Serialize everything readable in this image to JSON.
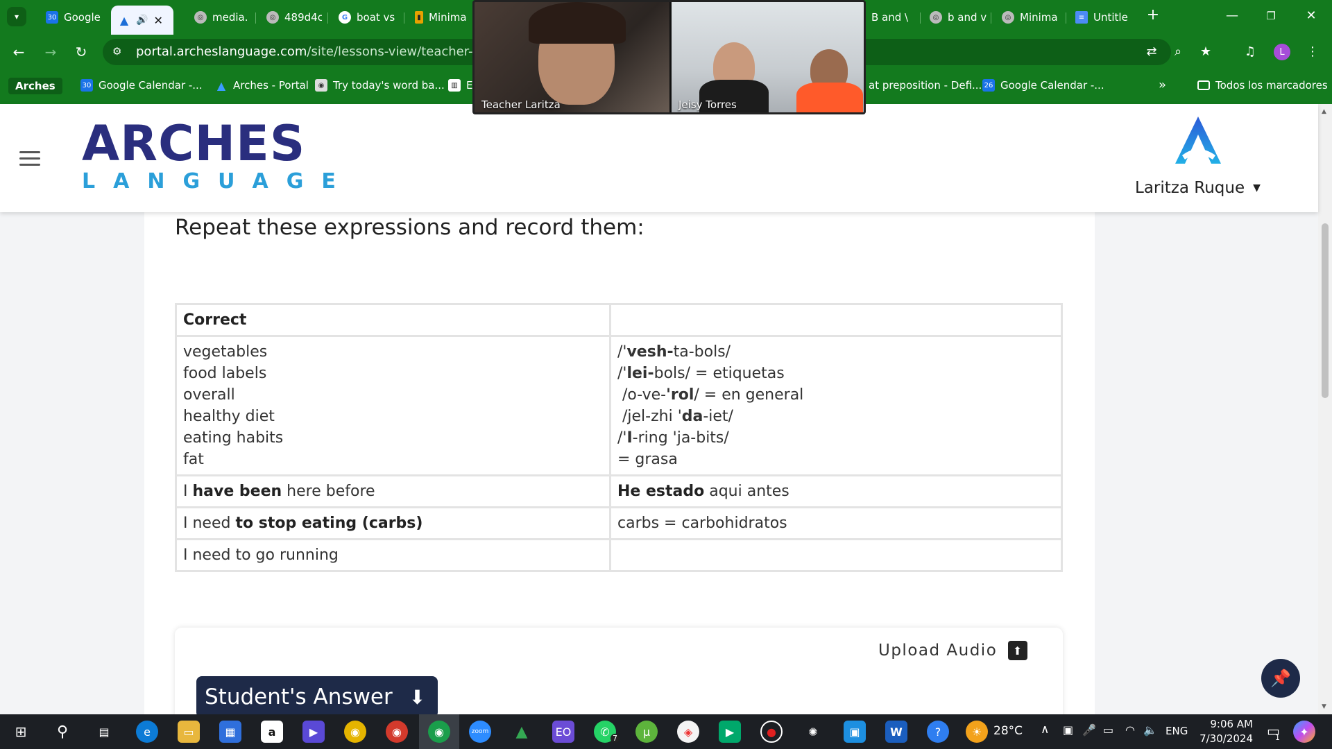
{
  "browser": {
    "tabs": [
      {
        "label": "Google",
        "icon": "calendar-icon"
      },
      {
        "label": "",
        "icon": "arches-icon",
        "active": true
      },
      {
        "label": "media.",
        "icon": "globe-icon"
      },
      {
        "label": "489d4c",
        "icon": "globe-icon"
      },
      {
        "label": "boat vs",
        "icon": "google-icon"
      },
      {
        "label": "Minima",
        "icon": "doc-icon"
      },
      {
        "label": "B and \\",
        "icon": "globe-icon"
      },
      {
        "label": "b and v",
        "icon": "globe-icon"
      },
      {
        "label": "Minima",
        "icon": "globe-icon"
      },
      {
        "label": "Untitle",
        "icon": "docs-icon"
      }
    ],
    "new_tab": "+",
    "url_domain": "portal.archeslanguage.com",
    "url_path": "/site/lessons-view/teacher-lesson/g",
    "bookmarks": {
      "arches": "Arches",
      "items": [
        {
          "label": "Google Calendar -..."
        },
        {
          "label": "Arches - Portal"
        },
        {
          "label": "Try today's word ba..."
        },
        {
          "label": "E"
        },
        {
          "label": "at preposition - Defi..."
        },
        {
          "label": "Google Calendar -..."
        }
      ],
      "more": "»",
      "all_bookmarks": "Todos los marcadores"
    },
    "profile_initial": "L"
  },
  "zoom": {
    "participant1": "Teacher Laritza",
    "participant2": "Jeisy Torres"
  },
  "site": {
    "logo_top": "ARCHES",
    "logo_bottom": "LANGUAGE",
    "user_name": "Laritza Ruque"
  },
  "lesson": {
    "instruction": "Repeat these expressions and record them:",
    "table": {
      "header_left": "Correct",
      "header_right": "",
      "words_left": [
        "vegetables",
        "food labels",
        "overall",
        "healthy diet",
        "eating habits",
        "fat"
      ],
      "row2_left_pre": "I ",
      "row2_left_bold": "have been",
      "row2_left_post": " here before",
      "row2_right_bold": "He estado",
      "row2_right_post": " aqui antes",
      "row3_left_pre": "I need ",
      "row3_left_bold": "to stop eating (carbs)",
      "row3_right": "carbs = carbohidratos",
      "row4_left": "I need to go running",
      "row4_right": ""
    },
    "upload_label": "Upload Audio",
    "student_answer": "Student's Answer"
  },
  "taskbar": {
    "temperature": "28°C",
    "language": "ENG",
    "time": "9:06 AM",
    "date": "7/30/2024",
    "notifications": "1",
    "whatsapp_badge": "7"
  },
  "colors": {
    "chrome_green": "#137a1e",
    "brand_navy": "#2a2e7e",
    "brand_blue": "#2b9fd9",
    "answer_button": "#1e2a48"
  }
}
